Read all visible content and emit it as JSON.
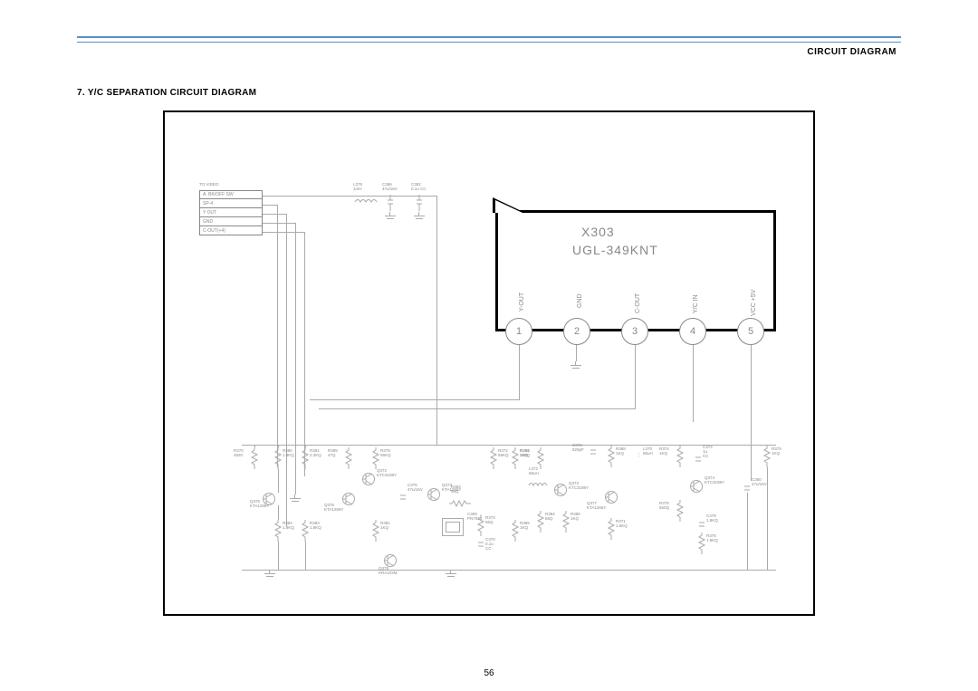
{
  "header": {
    "label": "CIRCUIT DIAGRAM"
  },
  "section": {
    "title": "7. Y/C SEPARATION CIRCUIT DIAGRAM"
  },
  "page_number": "56",
  "chip": {
    "ref": "X303",
    "part": "UGL-349KNT",
    "pins": [
      {
        "num": "1",
        "label": "Y-OUT"
      },
      {
        "num": "2",
        "label": "GND"
      },
      {
        "num": "3",
        "label": "C-OUT"
      },
      {
        "num": "4",
        "label": "Y/C IN"
      },
      {
        "num": "5",
        "label": "VCC +5V"
      }
    ]
  },
  "connector": {
    "title": "TO VIDEO",
    "rows": [
      "A. BK/OFF SW",
      "SP-4",
      "Y OUT",
      "GND",
      "C-OUT(+4)"
    ]
  },
  "top_components": {
    "l": {
      "ref": "L379",
      "val": "1mH"
    },
    "c1": {
      "ref": "C386",
      "val": "47u/16V"
    },
    "c2": {
      "ref": "C382",
      "val": "0.1u CC"
    }
  },
  "clusters": {
    "c1": {
      "r_top": {
        "ref": "R370",
        "val": "4820"
      },
      "r_mid": {
        "ref": "R380",
        "val": "1.8KQ"
      },
      "r_mid2": {
        "ref": "R381",
        "val": "2.2KQ"
      },
      "q": {
        "ref": "Q375",
        "val": "KTA1266Y"
      },
      "r_e1": {
        "ref": "R382",
        "val": "1.8KQ"
      },
      "r_e2": {
        "ref": "R383",
        "val": "1.8KQ"
      }
    },
    "c2": {
      "r_top": {
        "ref": "R399",
        "val": "47Q"
      },
      "r_mid": {
        "ref": "R378",
        "val": "56KQ"
      },
      "r_mid2": {
        "ref": "R381",
        "val": "1KQ"
      },
      "q1": {
        "ref": "Q372",
        "val": "KTC3198Y"
      },
      "q2": {
        "ref": "Q376",
        "val": "KTA1266Y"
      },
      "c": {
        "ref": "C375",
        "val": "47u/16V"
      },
      "q3": {
        "ref": "Q378",
        "val": "KRA102M"
      }
    },
    "c3": {
      "q": {
        "ref": "Q373",
        "val": "KTA1266Y"
      },
      "dl": {
        "ref": "DL301",
        "val": ""
      },
      "c1": {
        "ref": "C369",
        "val": "PN7014"
      },
      "r1": {
        "ref": "R373",
        "val": "56Q"
      },
      "c2": {
        "ref": "C370",
        "val": "0.1u CC"
      },
      "r2": {
        "ref": "R372",
        "val": "56KQ"
      },
      "r3": {
        "ref": "R364",
        "val": "220Q"
      },
      "r4": {
        "ref": "R363",
        "val": "56Q"
      },
      "r5": {
        "ref": "R365",
        "val": "1KQ"
      }
    },
    "c4": {
      "l": {
        "ref": "L372",
        "val": "56uH"
      },
      "q": {
        "ref": "Q373",
        "val": "KTC3198Y"
      },
      "r1": {
        "ref": "R385",
        "val": "1KQ"
      },
      "r2": {
        "ref": "R384",
        "val": "56Q"
      },
      "r3": {
        "ref": "R386",
        "val": "1KQ"
      }
    },
    "c5": {
      "c1": {
        "ref": "C376",
        "val": "820pF"
      },
      "r_top": {
        "ref": "R388",
        "val": "1KQ"
      },
      "l": {
        "ref": "L370",
        "val": "56uH"
      },
      "q": {
        "ref": "Q377",
        "val": "KTA1266Y"
      },
      "r_e": {
        "ref": "R371",
        "val": "1.5KQ"
      }
    },
    "c6": {
      "r_top": {
        "ref": "R374",
        "val": "1KQ"
      },
      "c": {
        "ref": "C374",
        "val": "1u CC"
      },
      "q": {
        "ref": "Q374",
        "val": "KTC3198Y"
      },
      "r_mid": {
        "ref": "R375",
        "val": "560Q"
      },
      "c2": {
        "ref": "C378",
        "val": "1.8KQ"
      },
      "r2": {
        "ref": "R376",
        "val": "1.8KQ"
      }
    },
    "c7": {
      "c": {
        "ref": "C380",
        "val": "47u/16V"
      },
      "r": {
        "ref": "R379",
        "val": "1KQ"
      }
    }
  }
}
